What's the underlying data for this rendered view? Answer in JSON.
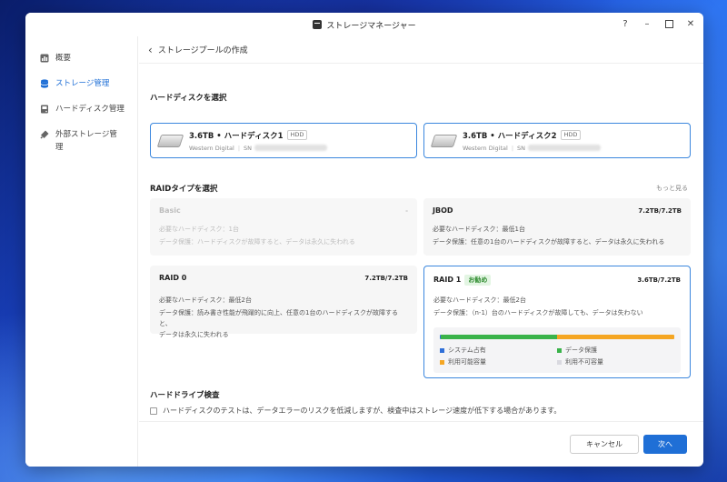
{
  "window": {
    "title": "ストレージマネージャー",
    "help": "?",
    "minimize": "–",
    "close": "✕"
  },
  "sidebar": {
    "items": [
      {
        "label": "概要"
      },
      {
        "label": "ストレージ管理"
      },
      {
        "label": "ハードディスク管理"
      },
      {
        "label": "外部ストレージ管理"
      }
    ]
  },
  "breadcrumb": {
    "back": "‹",
    "title": "ストレージプールの作成"
  },
  "disks_section": {
    "title": "ハードディスクを選択"
  },
  "disks": [
    {
      "name": "3.6TB • ハードディスク1",
      "type": "HDD",
      "vendor": "Western Digital",
      "sn_label": "SN"
    },
    {
      "name": "3.6TB • ハードディスク2",
      "type": "HDD",
      "vendor": "Western Digital",
      "sn_label": "SN"
    }
  ],
  "raid_section": {
    "title": "RAIDタイプを選択",
    "more": "もっと見る"
  },
  "raids": [
    {
      "name": "Basic",
      "capacity": "-",
      "required": "必要なハードディスク：1台",
      "protection": "データ保護：ハードディスクが故障すると、データは永久に失われる",
      "protection2": ""
    },
    {
      "name": "JBOD",
      "capacity": "7.2TB/7.2TB",
      "required": "必要なハードディスク：最低1台",
      "protection": "データ保護：任意の1台のハードディスクが故障すると、データは永久に失われる",
      "protection2": ""
    },
    {
      "name": "RAID 0",
      "capacity": "7.2TB/7.2TB",
      "required": "必要なハードディスク：最低2台",
      "protection": "データ保護：読み書き性能が飛躍的に向上、任意の1台のハードディスクが故障すると、",
      "protection2": "データは永久に失われる"
    },
    {
      "name": "RAID 1",
      "badge": "お勧め",
      "capacity": "3.6TB/7.2TB",
      "required": "必要なハードディスク：最低2台",
      "protection": "データ保護：（n-1）台のハードディスクが故障しても、データは失わない",
      "protection2": ""
    }
  ],
  "usage": {
    "segments": [
      {
        "name": "システム占有",
        "color": "#2f6fd8",
        "fraction": 0.004
      },
      {
        "name": "データ保護",
        "color": "#3ab34a",
        "fraction": 0.496
      },
      {
        "name": "利用可能容量",
        "color": "#f5a623",
        "fraction": 0.5
      },
      {
        "name": "利用不可容量",
        "color": "#d9d9e0",
        "fraction": 0.0
      }
    ]
  },
  "drive_check": {
    "title": "ハードドライブ検査",
    "text": "ハードディスクのテストは、データエラーのリスクを低減しますが、検査中はストレージ速度が低下する場合があります。"
  },
  "footer": {
    "cancel": "キャンセル",
    "next": "次へ"
  }
}
